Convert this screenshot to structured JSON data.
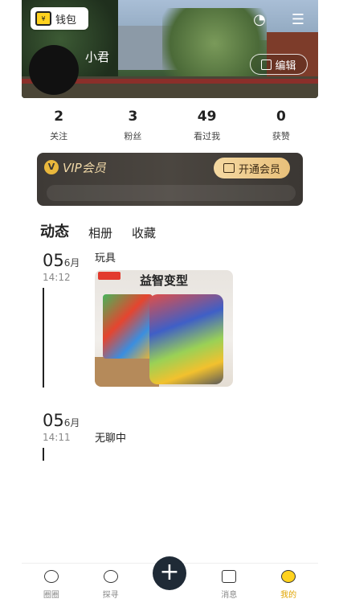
{
  "header": {
    "wallet_label": "钱包",
    "username": "小君",
    "edit_label": "编辑"
  },
  "stats": [
    {
      "value": "2",
      "label": "关注"
    },
    {
      "value": "3",
      "label": "粉丝"
    },
    {
      "value": "49",
      "label": "看过我"
    },
    {
      "value": "0",
      "label": "获赞"
    }
  ],
  "vip": {
    "title": "VIP会员",
    "open_label": "开通会员"
  },
  "tabs": [
    {
      "label": "动态"
    },
    {
      "label": "相册"
    },
    {
      "label": "收藏"
    }
  ],
  "posts": [
    {
      "day": "05",
      "month": "6月",
      "time": "14:12",
      "text": "玩具",
      "image_title": "益智变型"
    },
    {
      "day": "05",
      "month": "6月",
      "time": "14:11",
      "text": "无聊中"
    }
  ],
  "nav": [
    {
      "label": "圈圈",
      "icon": "circle-face-icon"
    },
    {
      "label": "探寻",
      "icon": "explore-icon"
    },
    {
      "label": "消息",
      "icon": "message-icon"
    },
    {
      "label": "我的",
      "icon": "me-face-icon"
    }
  ],
  "colors": {
    "accent": "#ffd21e",
    "vip_gold": "#f1d9a8",
    "fab": "#1f2a36"
  }
}
